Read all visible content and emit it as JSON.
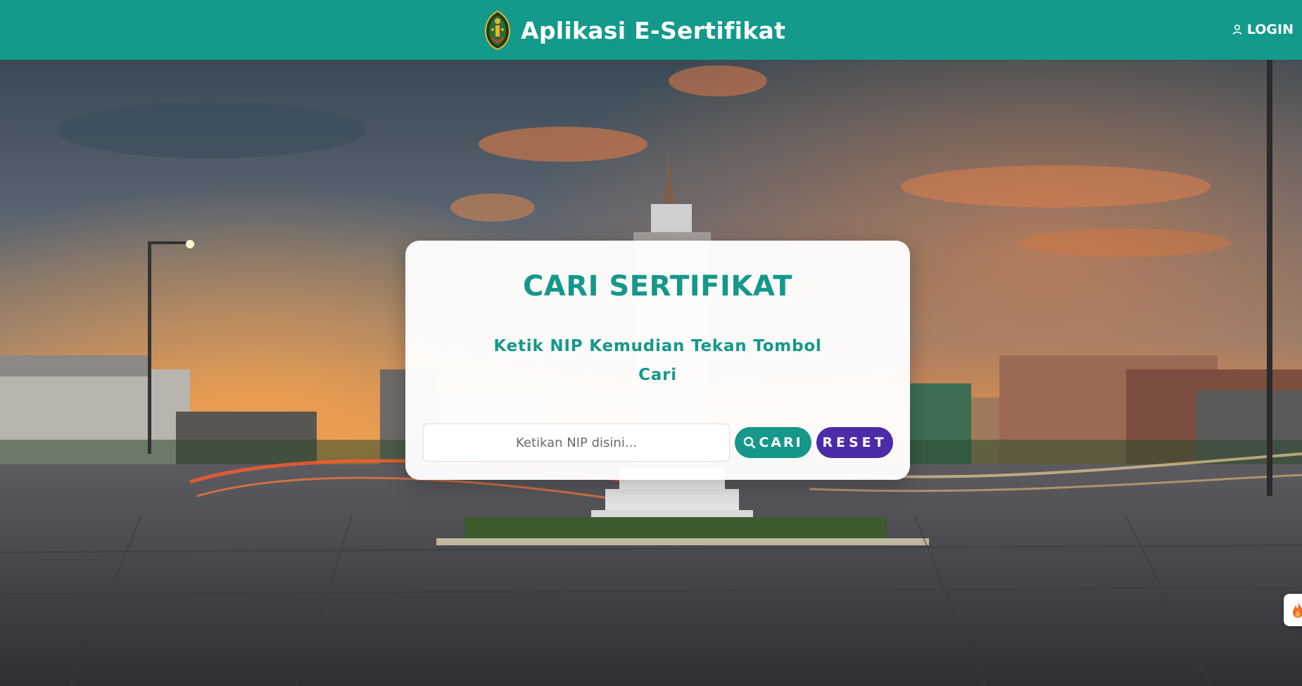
{
  "header": {
    "app_title": "Aplikasi E-Sertifikat",
    "logo_icon": "crest-logo",
    "login_label": "LOGIN",
    "login_icon": "user-icon",
    "background_color": "#139a8a"
  },
  "background": {
    "description_icon": "city-monument-sunset-photo"
  },
  "search_card": {
    "title": "CARI SERTIFIKAT",
    "subtitle": "Ketik NIP Kemudian Tekan Tombol Cari",
    "input": {
      "placeholder": "Ketikan NIP disini...",
      "value": ""
    },
    "search_button": {
      "label": "CARI",
      "icon": "search-icon",
      "color": "#15988a"
    },
    "reset_button": {
      "label": "RESET",
      "color": "#4c2aa8"
    }
  },
  "floating_widget": {
    "icon": "flame-icon"
  },
  "colors": {
    "primary": "#139a8a",
    "accent_text": "#15988a",
    "reset": "#4c2aa8"
  }
}
